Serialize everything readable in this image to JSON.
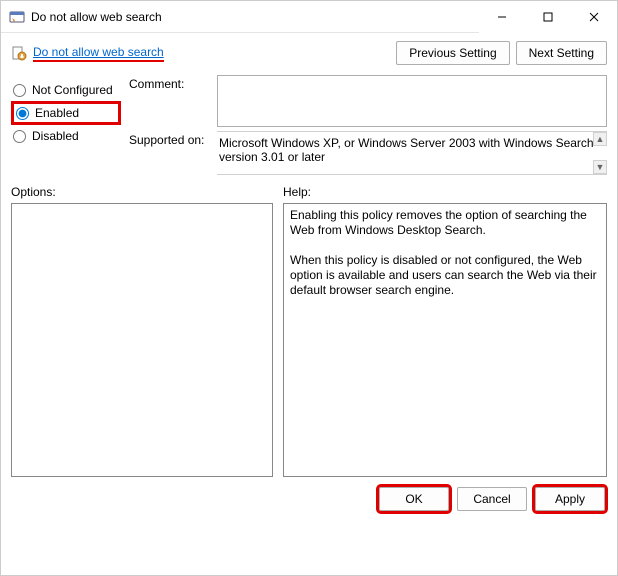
{
  "window": {
    "title": "Do not allow web search"
  },
  "header": {
    "policy_link": "Do not allow web search",
    "prev_btn": "Previous Setting",
    "next_btn": "Next Setting"
  },
  "radios": {
    "not_configured": "Not Configured",
    "enabled": "Enabled",
    "disabled": "Disabled",
    "selected": "enabled"
  },
  "meta": {
    "comment_label": "Comment:",
    "comment_value": "",
    "supported_label": "Supported on:",
    "supported_value": "Microsoft Windows XP, or Windows Server 2003 with Windows Search version 3.01 or later"
  },
  "labels": {
    "options": "Options:",
    "help": "Help:"
  },
  "options_content": "",
  "help_content": "Enabling this policy removes the option of searching the Web from Windows Desktop Search.\n\nWhen this policy is disabled or not configured, the Web option is available and users can search the Web via their default browser search engine.",
  "footer": {
    "ok": "OK",
    "cancel": "Cancel",
    "apply": "Apply"
  }
}
